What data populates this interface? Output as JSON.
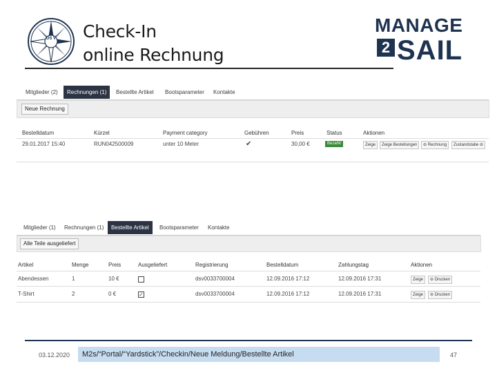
{
  "header": {
    "title_line1": "Check-In",
    "title_line2": "online Rechnung",
    "emblem_text": "DS V",
    "logo_top": "MANAGE",
    "logo_box": "2",
    "logo_bottom": "SAIL"
  },
  "shot1": {
    "tabs": [
      "Mitglieder (2)",
      "Rechnungen (1)",
      "Bestellte Artikel",
      "Bootsparameter",
      "Kontakte"
    ],
    "active_tab": 1,
    "new_button": "Neue Rechnung",
    "columns": [
      "Bestelldatum",
      "Kürzel",
      "Payment category",
      "Gebühren",
      "Preis",
      "Status",
      "Aktionen"
    ],
    "row": {
      "date": "29.01.2017 15:40",
      "code": "RUN042500009",
      "category": "unter 10 Meter",
      "fee_icon": "checkmark-icon",
      "price": "30,00 €",
      "status": "Bezahlt",
      "actions": [
        "Zeige",
        "Zeige Bestellungen",
        "⊖ Rechnung",
        "Zustandstabe ⊖"
      ]
    }
  },
  "shot2": {
    "tabs": [
      "Mitglieder (1)",
      "Rechnungen (1)",
      "Bestellte Artikel",
      "Bootsparameter",
      "Kontakte"
    ],
    "active_tab": 2,
    "ship_button": "Alle Teile ausgeliefert",
    "columns": [
      "Artikel",
      "Menge",
      "Preis",
      "Ausgeliefert",
      "Registrierung",
      "Bestelldatum",
      "Zahlungstag",
      "Aktionen"
    ],
    "rows": [
      {
        "item": "Abendessen",
        "qty": "1",
        "price": "10 €",
        "delivered": false,
        "reg": "dsv0033700004",
        "ordered": "12.09.2016 17:12",
        "paid": "12.09.2016 17:31",
        "actions": [
          "Zeige",
          "⊖ Drucken"
        ]
      },
      {
        "item": "T-Shirt",
        "qty": "2",
        "price": "0 €",
        "delivered": true,
        "reg": "dsv0033700004",
        "ordered": "12.09.2016 17:12",
        "paid": "12.09.2016 17:31",
        "actions": [
          "Zeige",
          "⊖ Drucken"
        ]
      }
    ]
  },
  "footer": {
    "date": "03.12.2020",
    "path": "M2s/“Portal/“Yardstick”/Checkin/Neue Meldung/Bestellte Artikel",
    "page": "47"
  },
  "colors": {
    "navy": "#1e3350",
    "active_tab": "#2c3444",
    "status_green": "#3a8a3a",
    "path_bg": "#c7dcf0"
  }
}
